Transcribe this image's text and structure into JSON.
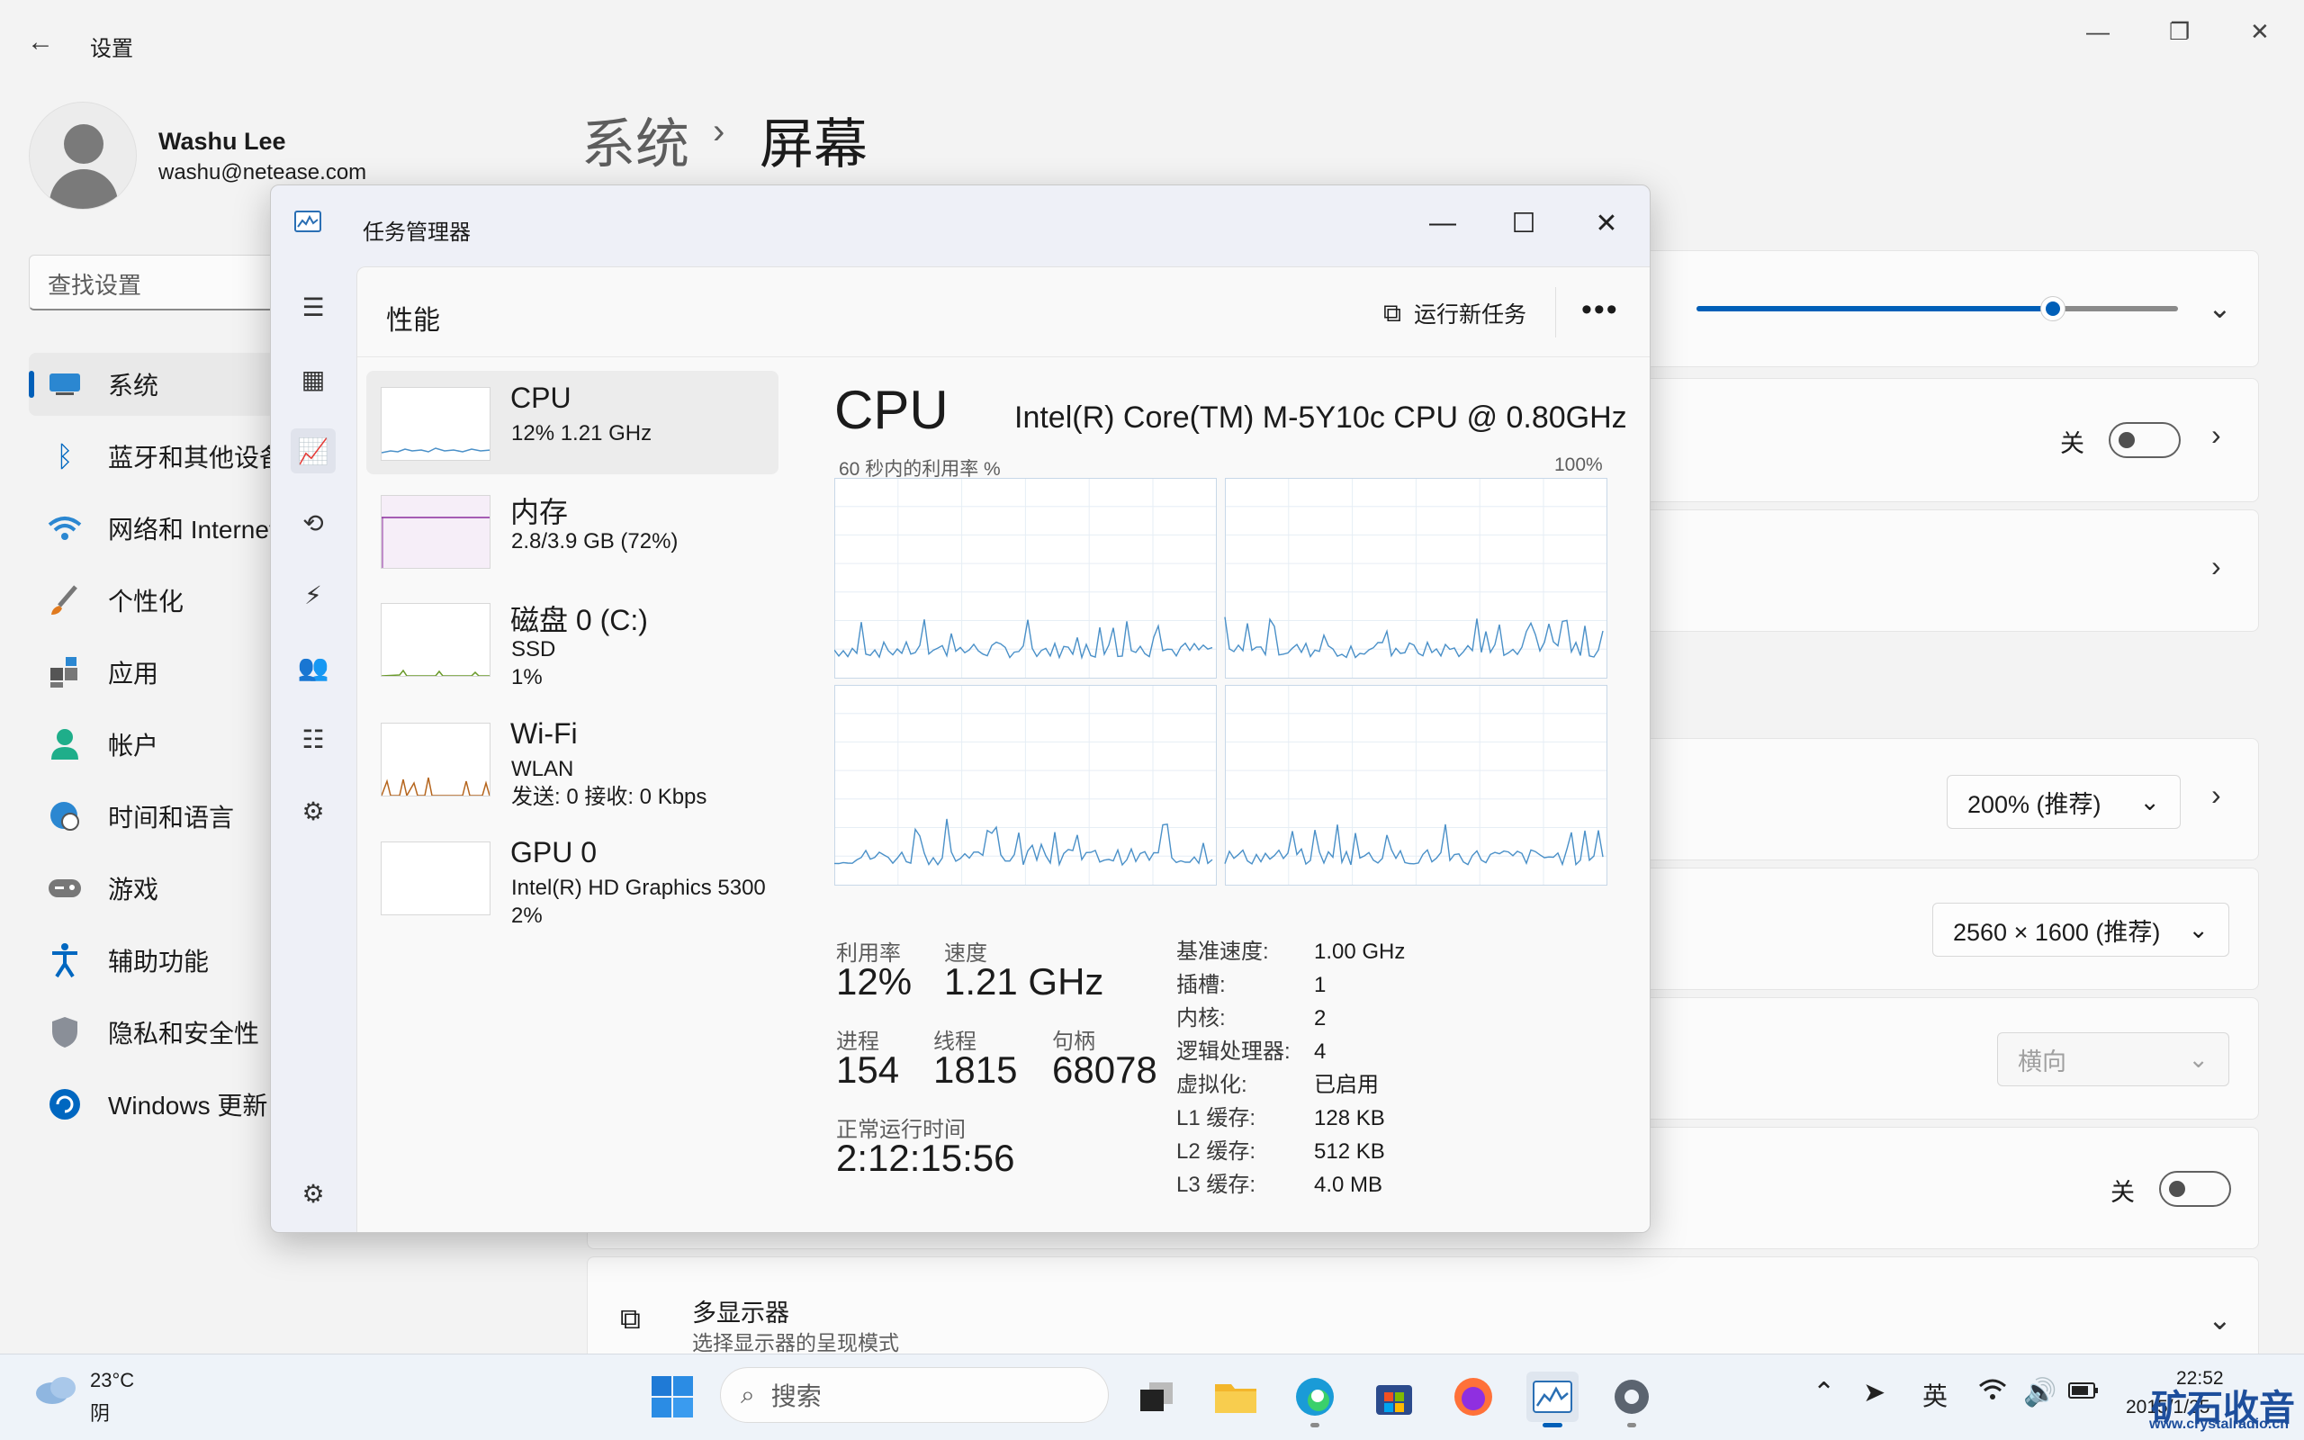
{
  "settings": {
    "title": "设置",
    "user": {
      "name": "Washu Lee",
      "email": "washu@netease.com"
    },
    "search_placeholder": "查找设置",
    "nav": [
      {
        "label": "系统",
        "icon": "monitor-icon"
      },
      {
        "label": "蓝牙和其他设备",
        "icon": "bluetooth-icon"
      },
      {
        "label": "网络和 Internet",
        "icon": "wifi-icon"
      },
      {
        "label": "个性化",
        "icon": "brush-icon"
      },
      {
        "label": "应用",
        "icon": "apps-icon"
      },
      {
        "label": "帐户",
        "icon": "account-icon"
      },
      {
        "label": "时间和语言",
        "icon": "globe-clock-icon"
      },
      {
        "label": "游戏",
        "icon": "gamepad-icon"
      },
      {
        "label": "辅助功能",
        "icon": "accessibility-icon"
      },
      {
        "label": "隐私和安全性",
        "icon": "shield-icon"
      },
      {
        "label": "Windows 更新",
        "icon": "update-icon"
      }
    ],
    "breadcrumb": {
      "parent": "系统",
      "current": "屏幕"
    },
    "brightness_level": 0.74,
    "toggle_off_label": "关",
    "scale_value": "200% (推荐)",
    "resolution_value": "2560 × 1600 (推荐)",
    "orientation_value": "横向",
    "multi_display": {
      "title": "多显示器",
      "subtitle": "选择显示器的呈现模式"
    }
  },
  "task_manager": {
    "title": "任务管理器",
    "section": "性能",
    "run_new_task": "运行新任务",
    "resources": [
      {
        "name": "CPU",
        "line1": "12% 1.21 GHz",
        "line2": ""
      },
      {
        "name": "内存",
        "line1": "2.8/3.9 GB (72%)",
        "line2": ""
      },
      {
        "name": "磁盘 0 (C:)",
        "line1": "SSD",
        "line2": "1%"
      },
      {
        "name": "Wi-Fi",
        "line1": "WLAN",
        "line2": "发送: 0 接收: 0 Kbps"
      },
      {
        "name": "GPU 0",
        "line1": "Intel(R) HD Graphics 5300",
        "line2": "2%"
      }
    ],
    "cpu": {
      "heading": "CPU",
      "model": "Intel(R) Core(TM) M-5Y10c CPU @ 0.80GHz",
      "graph_label": "60 秒内的利用率 %",
      "graph_max": "100%",
      "stats": {
        "util_label": "利用率",
        "util_value": "12%",
        "speed_label": "速度",
        "speed_value": "1.21 GHz",
        "proc_label": "进程",
        "proc_value": "154",
        "thread_label": "线程",
        "thread_value": "1815",
        "handle_label": "句柄",
        "handle_value": "68078",
        "uptime_label": "正常运行时间",
        "uptime_value": "2:12:15:56"
      },
      "details": [
        {
          "k": "基准速度:",
          "v": "1.00 GHz"
        },
        {
          "k": "插槽:",
          "v": "1"
        },
        {
          "k": "内核:",
          "v": "2"
        },
        {
          "k": "逻辑处理器:",
          "v": "4"
        },
        {
          "k": "虚拟化:",
          "v": "已启用"
        },
        {
          "k": "L1 缓存:",
          "v": "128 KB"
        },
        {
          "k": "L2 缓存:",
          "v": "512 KB"
        },
        {
          "k": "L3 缓存:",
          "v": "4.0 MB"
        }
      ]
    }
  },
  "taskbar": {
    "weather_temp": "23°C",
    "weather_state": "阴",
    "search_label": "搜索",
    "ime": "英",
    "clock_time": "22:52",
    "clock_date": "2015/1/25",
    "watermark": "矿石收音机",
    "watermark_url": "www.crystalradio.cn"
  },
  "colors": {
    "accent": "#005fb8",
    "graph_line": "#4a90c8",
    "mem_line": "#8b2c9c",
    "wifi_line": "#b5651d"
  }
}
